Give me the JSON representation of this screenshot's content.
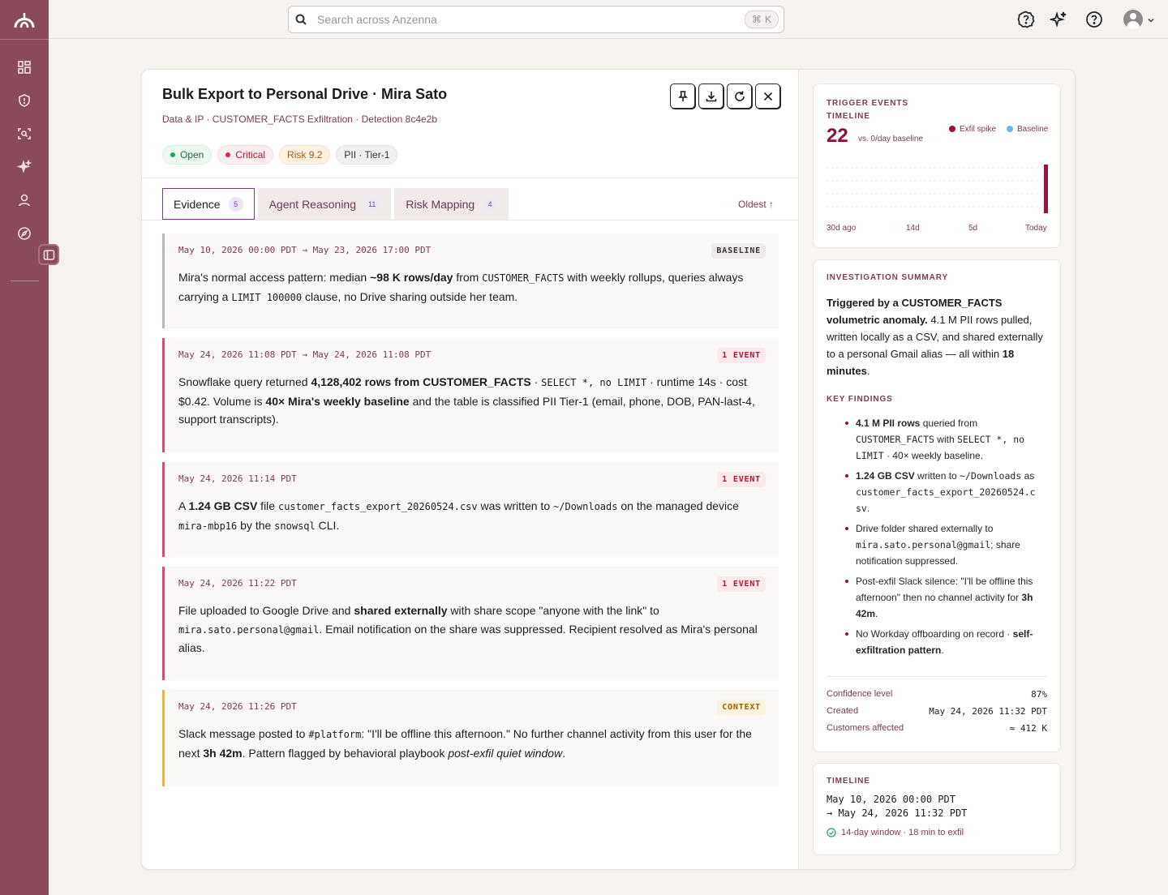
{
  "topbar": {
    "search_placeholder": "Search across Anzenna",
    "shortcut_mod": "⌘",
    "shortcut_key": "K"
  },
  "detection": {
    "title": "Bulk Export to Personal Drive · Mira Sato",
    "subtitle": "Data & IP · CUSTOMER_FACTS Exfiltration · Detection 8c4e2b",
    "badges": {
      "status": "Open",
      "severity": "Critical",
      "risk": "Risk 9.2",
      "classification": "PII · Tier-1"
    }
  },
  "tabs": [
    {
      "label": "Evidence",
      "count": "5"
    },
    {
      "label": "Agent Reasoning",
      "count": "11"
    },
    {
      "label": "Risk Mapping",
      "count": "4"
    }
  ],
  "sort_label": "Oldest ↑",
  "evidence": [
    {
      "timestamp": "May 10, 2026 00:00 PDT → May 23, 2026 17:00 PDT",
      "tag": "BASELINE"
    },
    {
      "timestamp": "May 24, 2026 11:08 PDT → May 24, 2026 11:08 PDT",
      "tag": "1 EVENT"
    },
    {
      "timestamp": "May 24, 2026 11:14 PDT",
      "tag": "1 EVENT"
    },
    {
      "timestamp": "May 24, 2026 11:22 PDT",
      "tag": "1 EVENT"
    },
    {
      "timestamp": "May 24, 2026 11:26 PDT",
      "tag": "CONTEXT"
    }
  ],
  "evidence_text": {
    "e1": [
      "Mira's normal access pattern: median ",
      "~98 K rows/day",
      " from ",
      "CUSTOMER_FACTS",
      " with weekly rollups, queries always carrying a ",
      "LIMIT 100000",
      " clause, no Drive sharing outside her team."
    ],
    "e2": [
      "Snowflake query returned ",
      "4,128,402 rows from CUSTOMER_FACTS",
      " · ",
      "SELECT *, no LIMIT",
      " · runtime 14s · cost $0.42. Volume is ",
      "40× Mira's weekly baseline",
      " and the table is classified PII Tier-1 (email, phone, DOB, PAN-last-4, support transcripts)."
    ],
    "e3": [
      "A ",
      "1.24 GB CSV",
      " file ",
      "customer_facts_export_20260524.csv",
      " was written to ",
      "~/Downloads",
      " on the managed device ",
      "mira-mbp16",
      " by the ",
      "snowsql",
      " CLI."
    ],
    "e4": [
      "File uploaded to Google Drive and ",
      "shared externally",
      " with share scope \"anyone with the link\" to ",
      "mira.sato.personal@gmail",
      ". Email notification on the share was suppressed. Recipient resolved as Mira's personal alias."
    ],
    "e5": [
      "Slack message posted to ",
      "#platform",
      ": \"I'll be offline this afternoon.\" No further channel activity from this user for the next ",
      "3h 42m",
      ". Pattern flagged by behavioral playbook ",
      "post-exfil quiet window",
      "."
    ]
  },
  "trigger": {
    "label_line1": "TRIGGER EVENTS",
    "label_line2": "TIMELINE",
    "count": "22",
    "vs_text": "vs. 0/day baseline",
    "legend_exfil": "Exfil spike",
    "legend_baseline": "Baseline",
    "x_ticks": [
      "30d ago",
      "14d",
      "5d",
      "Today"
    ],
    "colors": {
      "exfil": "#a0103f",
      "baseline": "#6bb8ec"
    }
  },
  "chart_data": {
    "type": "bar",
    "categories": [
      "30d ago",
      "14d",
      "5d",
      "Today"
    ],
    "series": [
      {
        "name": "Exfil spike",
        "values": [
          0,
          0,
          0,
          22
        ]
      },
      {
        "name": "Baseline",
        "values": [
          0,
          0,
          0,
          0
        ]
      }
    ],
    "title": "TRIGGER EVENTS TIMELINE",
    "ylim": [
      0,
      22
    ]
  },
  "summary": {
    "label": "INVESTIGATION SUMMARY",
    "bold": "Triggered by a CUSTOMER_FACTS volumetric anomaly.",
    "text": " 4.1 M PII rows pulled, written locally as a CSV, and shared externally to a personal Gmail alias — all within ",
    "bold2": "18 minutes",
    "end": ".",
    "findings_label": "KEY FINDINGS",
    "f1": [
      "4.1 M PII rows",
      " queried from ",
      "CUSTOMER_FACTS",
      " with ",
      "SELECT *, no LIMIT",
      " · 40× weekly baseline."
    ],
    "f2": [
      "1.24 GB CSV",
      " written to ",
      "~/Downloads",
      " as ",
      "customer_facts_export_20260524.csv",
      "."
    ],
    "f3": [
      "Drive folder shared externally to ",
      "mira.sato.personal@gmail",
      "; share notification suppressed."
    ],
    "f4": [
      "Post-exfil Slack silence: \"I'll be offline this afternoon\" then no channel activity for ",
      "3h 42m",
      "."
    ],
    "f5": [
      "No Workday offboarding on record · ",
      "self-exfiltration pattern",
      "."
    ],
    "confidence_label": "Confidence level",
    "confidence_value": "87%",
    "created_label": "Created",
    "created_value": "May 24, 2026 11:32 PDT",
    "customers_label": "Customers affected",
    "customers_value": "≈ 412 K"
  },
  "timeline": {
    "label": "TIMELINE",
    "start": "May 10, 2026 00:00 PDT",
    "end": "→ May 24, 2026 11:32 PDT",
    "window": "14-day window · 18 min to exfil"
  }
}
